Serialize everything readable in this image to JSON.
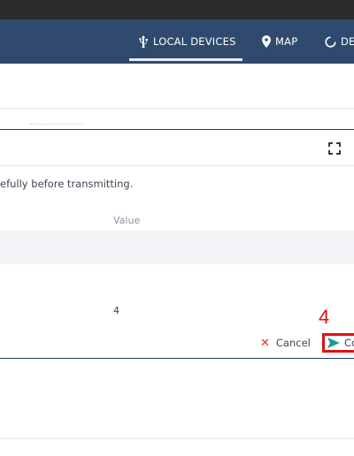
{
  "navbar": {
    "tabs": [
      {
        "label": "LOCAL DEVICES",
        "icon": "usb-icon",
        "active": true
      },
      {
        "label": "MAP",
        "icon": "map-pin-icon",
        "active": false
      },
      {
        "label": "DE",
        "icon": "circle-icon",
        "active": false
      }
    ]
  },
  "dialog": {
    "warning_text": "efully before transmitting.",
    "column_header": "Value",
    "row_value": "4",
    "cancel_label": "Cancel",
    "confirm_label": "Co"
  },
  "annotation": {
    "step": "4",
    "color": "#e01010"
  },
  "colors": {
    "navbar": "#2f4a6d",
    "accent": "#1a9b8a",
    "cancel": "#d9342b"
  }
}
